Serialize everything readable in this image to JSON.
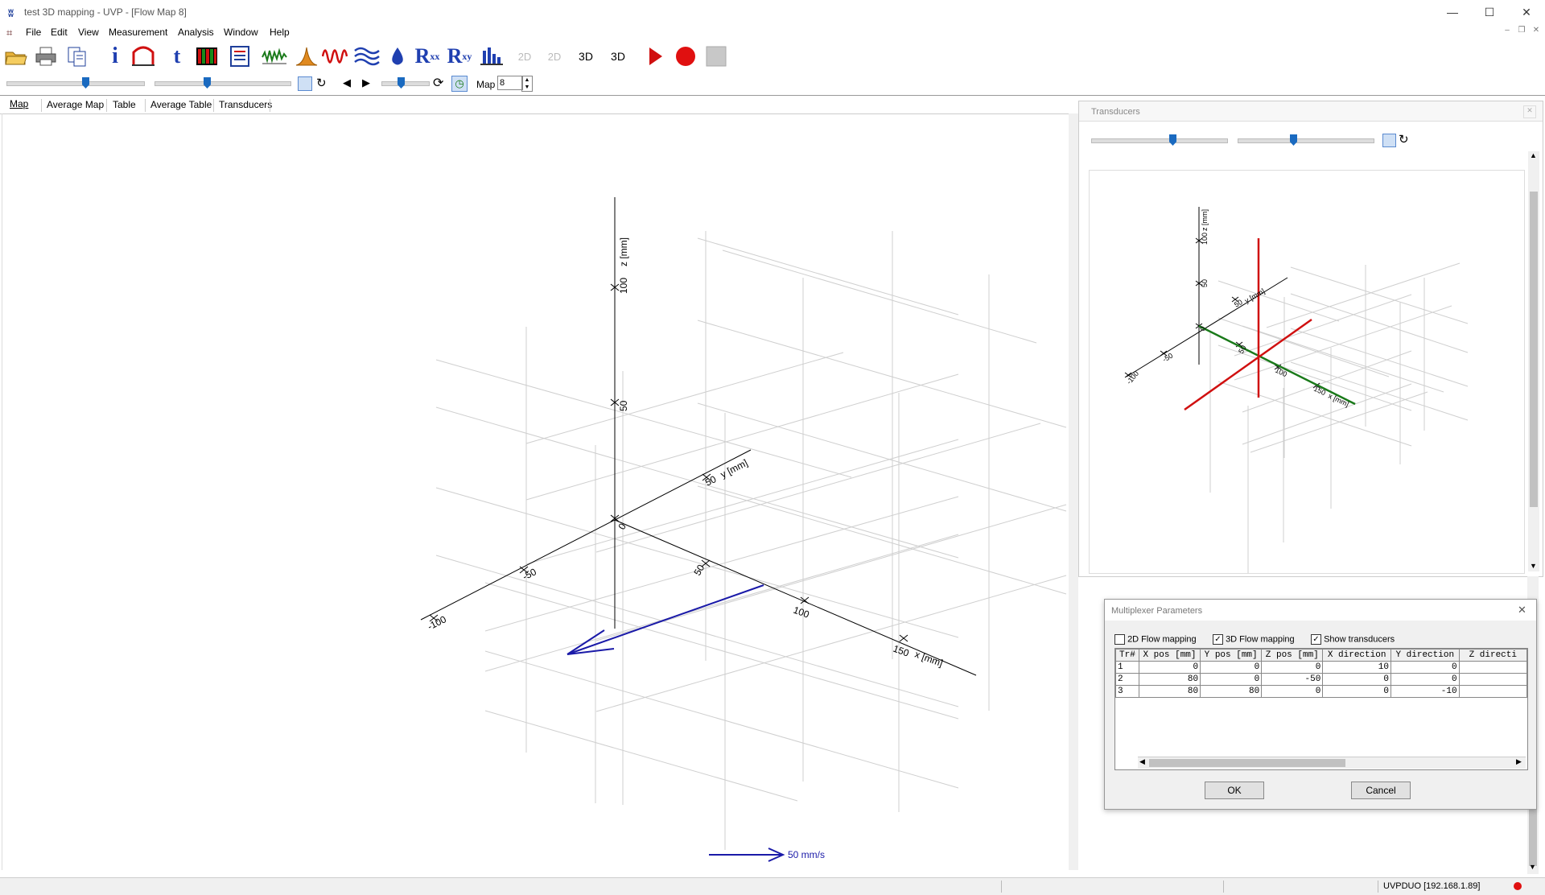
{
  "window": {
    "title": "test 3D mapping - UVP - [Flow Map 8]"
  },
  "menu": [
    "File",
    "Edit",
    "View",
    "Measurement",
    "Analysis",
    "Window",
    "Help"
  ],
  "toolbar": {
    "rxx_label": "R",
    "rxx_sub": "xx",
    "rxy_label": "R",
    "rxy_sub": "xy",
    "twod1": "2D",
    "twod2": "2D",
    "threed1": "3D",
    "threed2": "3D",
    "map_label": "Map",
    "map_value": "8"
  },
  "tabs": [
    "Map",
    "Average Map",
    "Table",
    "Average Table",
    "Transducers"
  ],
  "plot": {
    "z_axis_label": "z [mm]",
    "y_axis_label": "y [mm]",
    "x_axis_label": "x [mm]",
    "z_ticks": [
      "100",
      "50",
      "0"
    ],
    "y_ticks": [
      "50",
      "-100",
      "-50"
    ],
    "x_ticks": [
      "50",
      "100",
      "150"
    ],
    "legend_text": "50 mm/s",
    "vector_color": "#1a1aa8"
  },
  "transducers_panel": {
    "title": "Transducers",
    "z_label": "z [mm]",
    "y_label": "y [mm]",
    "x_label": "x [mm]",
    "z_ticks": [
      "100",
      "50",
      "0"
    ],
    "y_ticks": [
      "50",
      "-50",
      "-100"
    ],
    "x_ticks": [
      "50",
      "100",
      "150"
    ],
    "colors": {
      "red": "#d01010",
      "green": "#1a7a1a"
    }
  },
  "multiplexer": {
    "title": "Multiplexer Parameters",
    "opt_2d": "2D Flow mapping",
    "opt_3d": "3D Flow mapping",
    "opt_show": "Show transducers",
    "columns": [
      "Tr#",
      "X pos [mm]",
      "Y pos [mm]",
      "Z pos [mm]",
      "X direction",
      "Y direction",
      "Z directi"
    ],
    "rows": [
      [
        "1",
        "0",
        "0",
        "0",
        "10",
        "0",
        ""
      ],
      [
        "2",
        "80",
        "0",
        "-50",
        "0",
        "0",
        ""
      ],
      [
        "3",
        "80",
        "80",
        "0",
        "0",
        "-10",
        ""
      ]
    ],
    "ok": "OK",
    "cancel": "Cancel"
  },
  "status": {
    "device": "UVPDUO [192.168.1.89]"
  }
}
